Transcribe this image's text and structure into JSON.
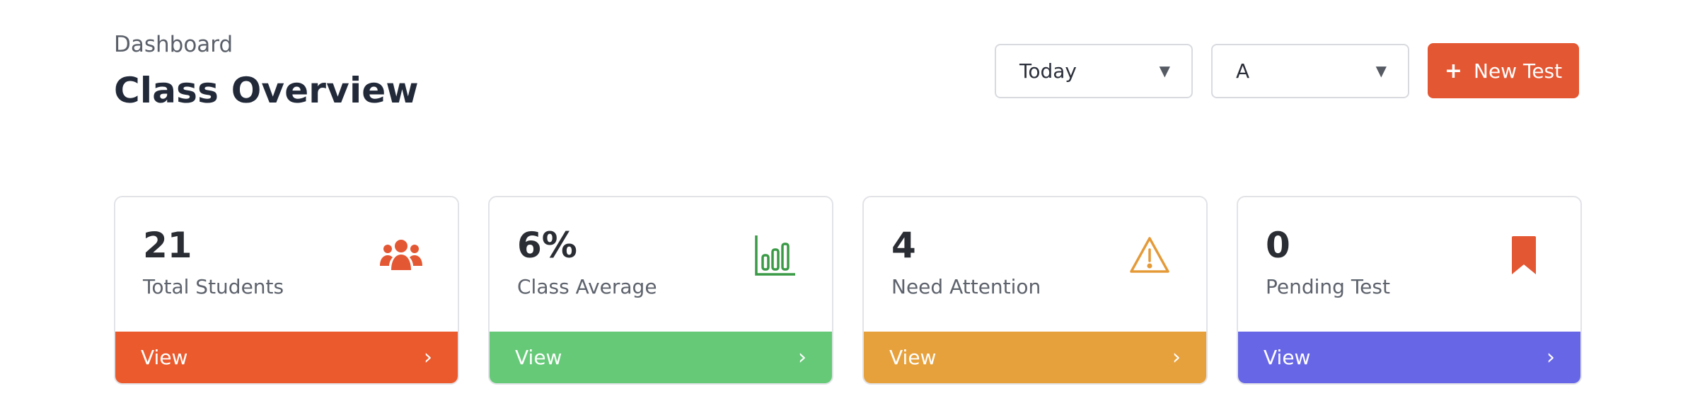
{
  "header": {
    "breadcrumb": "Dashboard",
    "title": "Class Overview"
  },
  "controls": {
    "period_select": "Today",
    "section_select": "A",
    "new_test_label": "New Test",
    "new_test_icon": "plus-icon",
    "accent": "#e45733"
  },
  "cards": [
    {
      "value": "21",
      "label": "Total Students",
      "icon": "users-icon",
      "icon_color": "#e45733",
      "footer_label": "View",
      "footer_color": "#ea5a2c"
    },
    {
      "value": "6%",
      "label": "Class Average",
      "icon": "bar-chart-icon",
      "icon_color": "#3a9a46",
      "footer_label": "View",
      "footer_color": "#65c978"
    },
    {
      "value": "4",
      "label": "Need Attention",
      "icon": "warning-icon",
      "icon_color": "#e59a38",
      "footer_label": "View",
      "footer_color": "#e7a13c"
    },
    {
      "value": "0",
      "label": "Pending Test",
      "icon": "bookmark-icon",
      "icon_color": "#e45733",
      "footer_label": "View",
      "footer_color": "#6766e6"
    }
  ]
}
